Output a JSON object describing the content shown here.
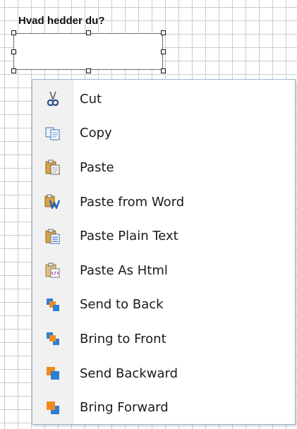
{
  "form": {
    "label": "Hvad hedder du?"
  },
  "context_menu": {
    "items": [
      {
        "label": "Cut",
        "icon": "cut-icon"
      },
      {
        "label": "Copy",
        "icon": "copy-icon"
      },
      {
        "label": "Paste",
        "icon": "paste-icon"
      },
      {
        "label": "Paste from Word",
        "icon": "paste-from-word-icon"
      },
      {
        "label": "Paste Plain Text",
        "icon": "paste-plain-text-icon"
      },
      {
        "label": "Paste As Html",
        "icon": "paste-as-html-icon"
      },
      {
        "label": "Send to Back",
        "icon": "send-to-back-icon"
      },
      {
        "label": "Bring to Front",
        "icon": "bring-to-front-icon"
      },
      {
        "label": "Send Backward",
        "icon": "send-backward-icon"
      },
      {
        "label": "Bring Forward",
        "icon": "bring-forward-icon"
      }
    ]
  },
  "colors": {
    "grid_line": "#c9ccd2",
    "menu_border": "#9fb5cf",
    "icon_gutter": "#f1f1f1",
    "accent_blue": "#2d7fd1",
    "accent_orange": "#f08a1d"
  }
}
